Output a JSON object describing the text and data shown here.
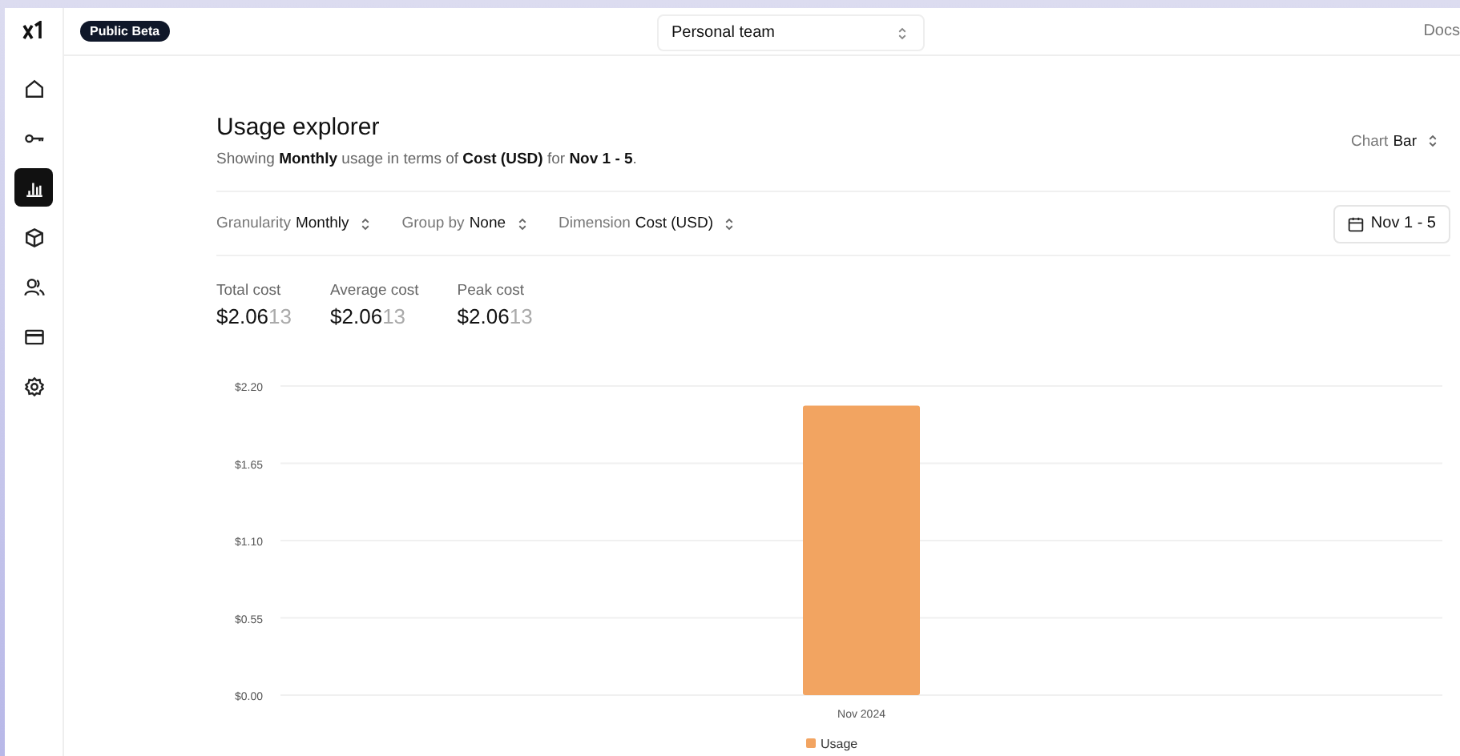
{
  "header": {
    "badge": "Public Beta",
    "team_select": "Personal team",
    "docs_link": "Docs"
  },
  "sidebar": {
    "items": [
      {
        "kind": "home",
        "selected": false
      },
      {
        "kind": "key",
        "selected": false
      },
      {
        "kind": "chart",
        "selected": true
      },
      {
        "kind": "cube",
        "selected": false
      },
      {
        "kind": "users",
        "selected": false
      },
      {
        "kind": "card",
        "selected": false
      },
      {
        "kind": "gear",
        "selected": false
      }
    ]
  },
  "page": {
    "title": "Usage explorer",
    "subtitle": "Showing **Monthly** usage in terms of **Cost (USD)** for **Nov 1 - 5**.",
    "chart_select": {
      "label": "Chart",
      "value": "Bar"
    },
    "filters": [
      {
        "label": "Granularity",
        "value": "Monthly"
      },
      {
        "label": "Group by",
        "value": "None"
      },
      {
        "label": "Dimension",
        "value": "Cost (USD)"
      }
    ],
    "date_button": "Nov 1 - 5",
    "stats": [
      {
        "label": "Total cost",
        "value": "$2.06",
        "tail": "13"
      },
      {
        "label": "Average cost",
        "value": "$2.06",
        "tail": "13"
      },
      {
        "label": "Peak cost",
        "value": "$2.06",
        "tail": "13"
      }
    ],
    "chart_data": {
      "type": "bar",
      "categories": [
        "Nov 2024"
      ],
      "series": [
        {
          "name": "Usage",
          "color": "#f2a461",
          "values": [
            2.06
          ]
        }
      ],
      "ylim": [
        0,
        2.2
      ],
      "grid": true,
      "yticks": [
        {
          "value": 0,
          "label": "$0.00"
        },
        {
          "value": 0.55,
          "label": "$0.55"
        },
        {
          "value": 1.1,
          "label": "$1.10"
        },
        {
          "value": 1.65,
          "label": "$1.65"
        },
        {
          "value": 2.2,
          "label": "$2.20"
        }
      ]
    }
  }
}
